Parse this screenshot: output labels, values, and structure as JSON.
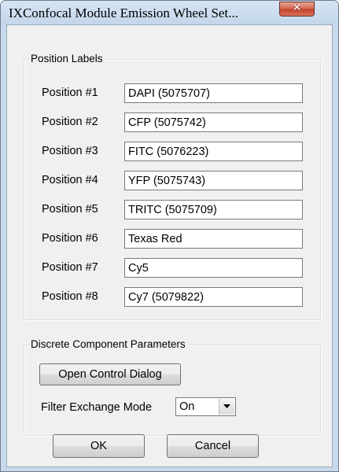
{
  "window": {
    "title": "IXConfocal Module Emission Wheel Set..."
  },
  "position_labels": {
    "group_title": "Position Labels",
    "rows": [
      {
        "label": "Position #1",
        "value": "DAPI (5075707)"
      },
      {
        "label": "Position #2",
        "value": "CFP (5075742)"
      },
      {
        "label": "Position #3",
        "value": "FITC (5076223)"
      },
      {
        "label": "Position #4",
        "value": "YFP (5075743)"
      },
      {
        "label": "Position #5",
        "value": "TRITC (5075709)"
      },
      {
        "label": "Position #6",
        "value": "Texas Red"
      },
      {
        "label": "Position #7",
        "value": "Cy5"
      },
      {
        "label": "Position #8",
        "value": "Cy7 (5079822)"
      }
    ]
  },
  "discrete": {
    "group_title": "Discrete Component Parameters",
    "open_button": "Open Control Dialog",
    "filter_mode_label": "Filter Exchange Mode",
    "filter_mode_value": "On"
  },
  "buttons": {
    "ok": "OK",
    "cancel": "Cancel"
  },
  "icons": {
    "close": "close-icon",
    "dropdown": "chevron-down-icon"
  },
  "colors": {
    "close_button": "#c2402a",
    "frame": "#c8d9ec",
    "client": "#f0f0f0"
  }
}
